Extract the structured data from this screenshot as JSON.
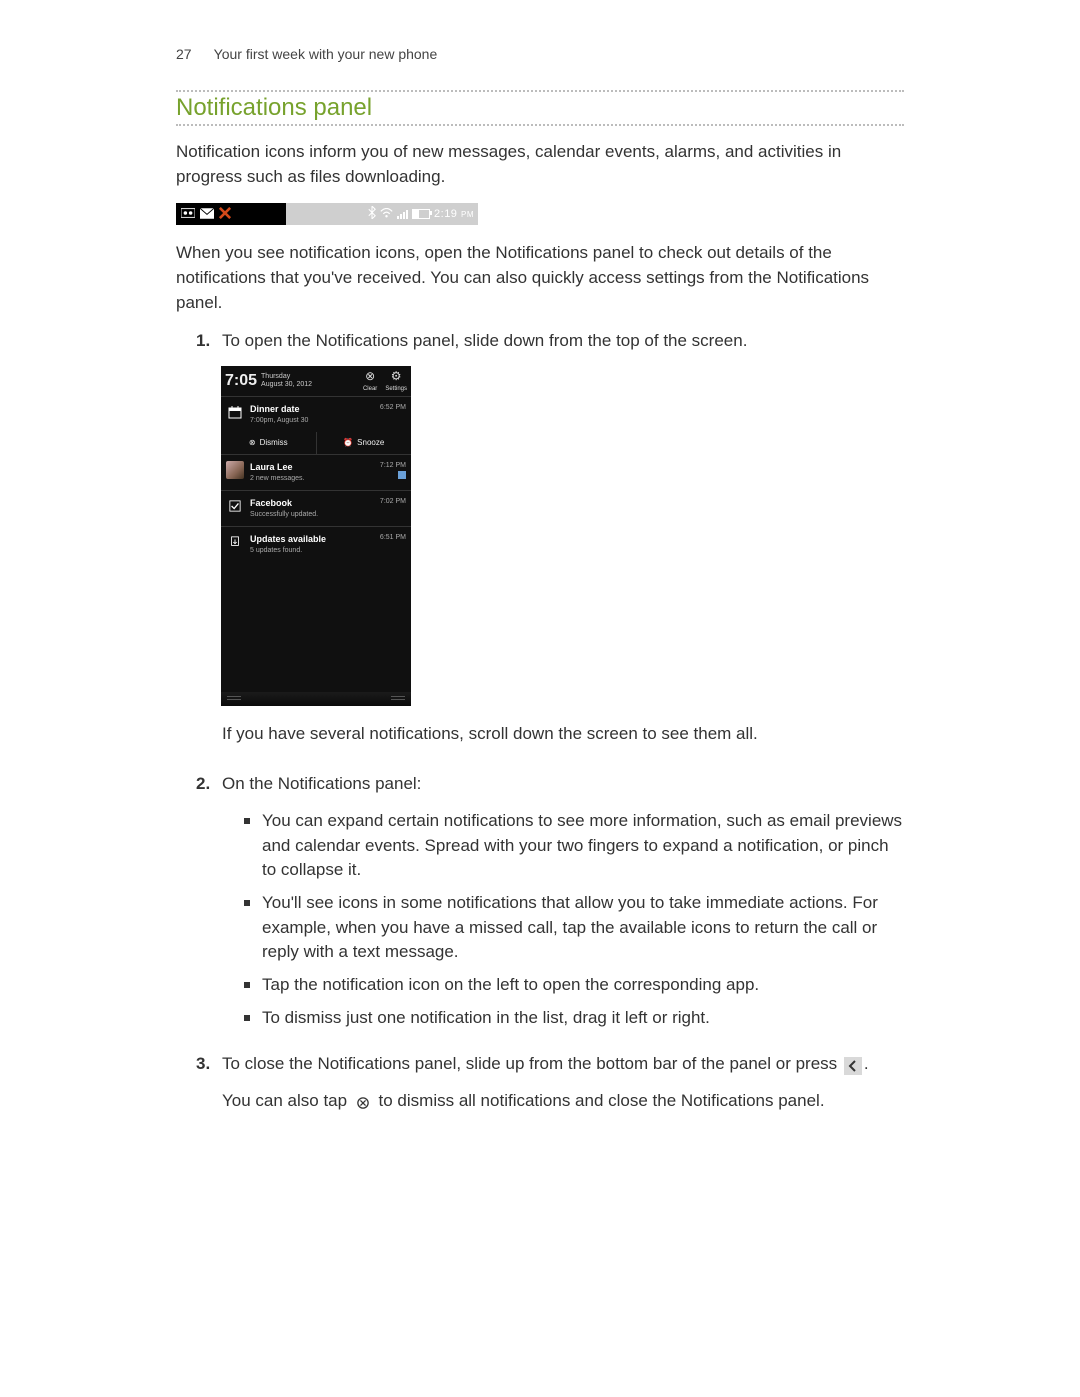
{
  "header": {
    "page_number": "27",
    "chapter": "Your first week with your new phone"
  },
  "section_title": "Notifications panel",
  "intro_paragraph": "Notification icons inform you of new messages, calendar events, alarms, and activities in progress such as files downloading.",
  "status_bar": {
    "clock": "2:19",
    "clock_suffix": "PM"
  },
  "after_statusbar_paragraph": "When you see notification icons, open the Notifications panel to check out details of the notifications that you've received. You can also quickly access settings from the Notifications panel.",
  "steps": {
    "s1": {
      "text": "To open the Notifications panel, slide down from the top of the screen.",
      "after": "If you have several notifications, scroll down the screen to see them all."
    },
    "s2": {
      "text": "On the Notifications panel:",
      "bullets": {
        "b1": "You can expand certain notifications to see more information, such as email previews and calendar events. Spread with your two fingers to expand a notification, or pinch to collapse it.",
        "b2": "You'll see icons in some notifications that allow you to take immediate actions. For example, when you have a missed call, tap the available icons to return the call or reply with a text message.",
        "b3": "Tap the notification icon on the left to open the corresponding app.",
        "b4": "To dismiss just one notification in the list, drag it left or right."
      }
    },
    "s3": {
      "part_a": "To close the Notifications panel, slide up from the bottom bar of the panel or press ",
      "part_b": ".",
      "tail_a": "You can also tap ",
      "tail_b": " to dismiss all notifications and close the Notifications panel."
    }
  },
  "phone": {
    "time": "7:05",
    "day": "Thursday",
    "date": "August 30, 2012",
    "clear_label": "Clear",
    "settings_label": "Settings",
    "notif1": {
      "title": "Dinner date",
      "sub": "7:00pm, August 30",
      "time": "6:52 PM"
    },
    "actions": {
      "dismiss": "Dismiss",
      "snooze": "Snooze"
    },
    "notif2": {
      "title": "Laura Lee",
      "sub": "2 new messages.",
      "time": "7:12 PM"
    },
    "notif3": {
      "title": "Facebook",
      "sub": "Successfully updated.",
      "time": "7:02 PM"
    },
    "notif4": {
      "title": "Updates available",
      "sub": "5 updates found.",
      "time": "6:51 PM"
    }
  }
}
